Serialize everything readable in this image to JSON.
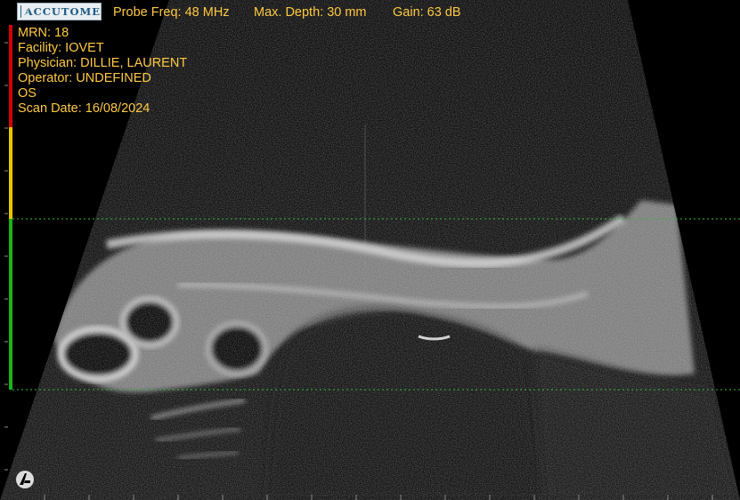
{
  "logo": {
    "text": "ACCUTOME"
  },
  "header": {
    "probe_freq": "Probe Freq: 48 MHz",
    "max_depth": "Max. Depth: 30 mm",
    "gain": "Gain: 63 dB"
  },
  "patient": {
    "mrn": "MRN: 18",
    "facility": "Facility: IOVET",
    "physician": "Physician: DILLIE, LAURENT",
    "operator": "Operator: UNDEFINED",
    "eye": "OS",
    "scan_date": "Scan Date: 16/08/2024"
  },
  "colors": {
    "text": "#ffc940",
    "gain_red": "#d40000",
    "gain_yellow": "#e6c800",
    "gain_green": "#19b418",
    "gate_line": "#2fbf3a"
  },
  "icons": {
    "corner_brand": "accutome-a-icon"
  }
}
